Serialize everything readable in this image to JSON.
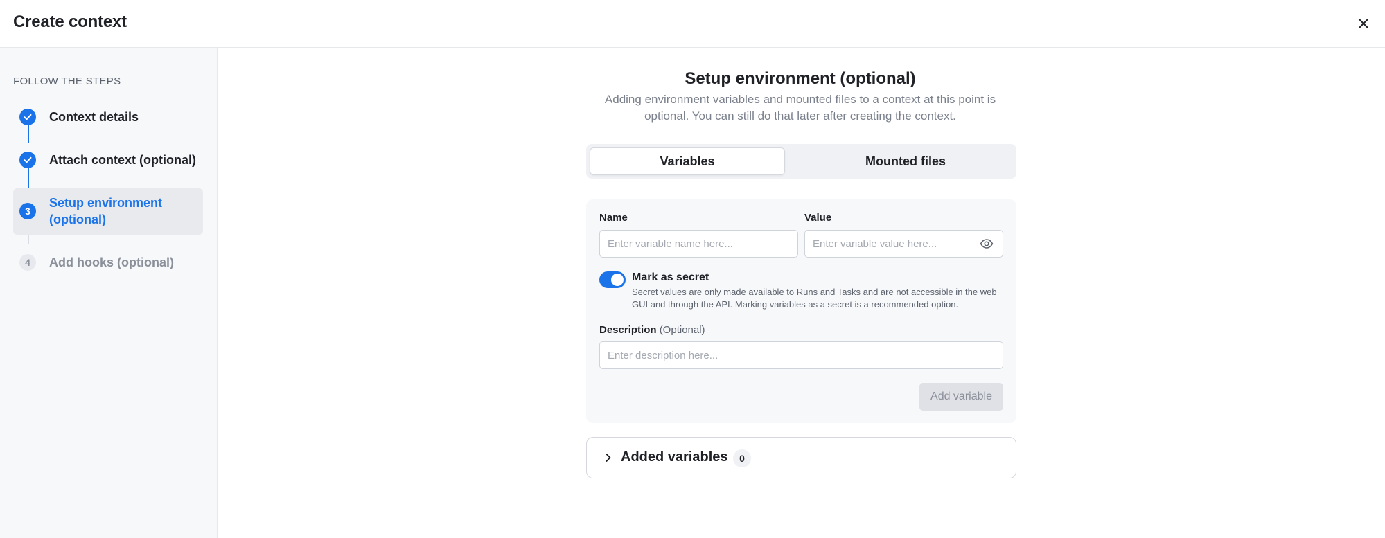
{
  "header": {
    "title": "Create context",
    "close_icon": "close-icon"
  },
  "sidebar": {
    "heading": "FOLLOW THE STEPS",
    "steps": [
      {
        "number": "1",
        "label": "Context details",
        "state": "done"
      },
      {
        "number": "2",
        "label": "Attach context (optional)",
        "state": "done"
      },
      {
        "number": "3",
        "label": "Setup environment (optional)",
        "state": "current"
      },
      {
        "number": "4",
        "label": "Add hooks (optional)",
        "state": "pending"
      }
    ]
  },
  "main": {
    "title": "Setup environment (optional)",
    "subtitle": "Adding environment variables and mounted files to a context at this point is optional. You can still do that later after creating the context.",
    "tabs": [
      {
        "label": "Variables",
        "active": true
      },
      {
        "label": "Mounted files",
        "active": false
      }
    ],
    "form": {
      "name_label": "Name",
      "name_placeholder": "Enter variable name here...",
      "value_label": "Value",
      "value_placeholder": "Enter variable value here...",
      "secret_toggle_on": true,
      "secret_title": "Mark as secret",
      "secret_desc": "Secret values are only made available to Runs and Tasks and are not accessible in the web GUI and through the API. Marking variables as a secret is a recommended option.",
      "description_label": "Description",
      "description_optional": "(Optional)",
      "description_placeholder": "Enter description here...",
      "add_button": "Add variable"
    },
    "added": {
      "title": "Added variables",
      "count": "0"
    }
  },
  "colors": {
    "accent": "#1a73e8",
    "text": "#1f2126",
    "muted": "#7b818c"
  }
}
